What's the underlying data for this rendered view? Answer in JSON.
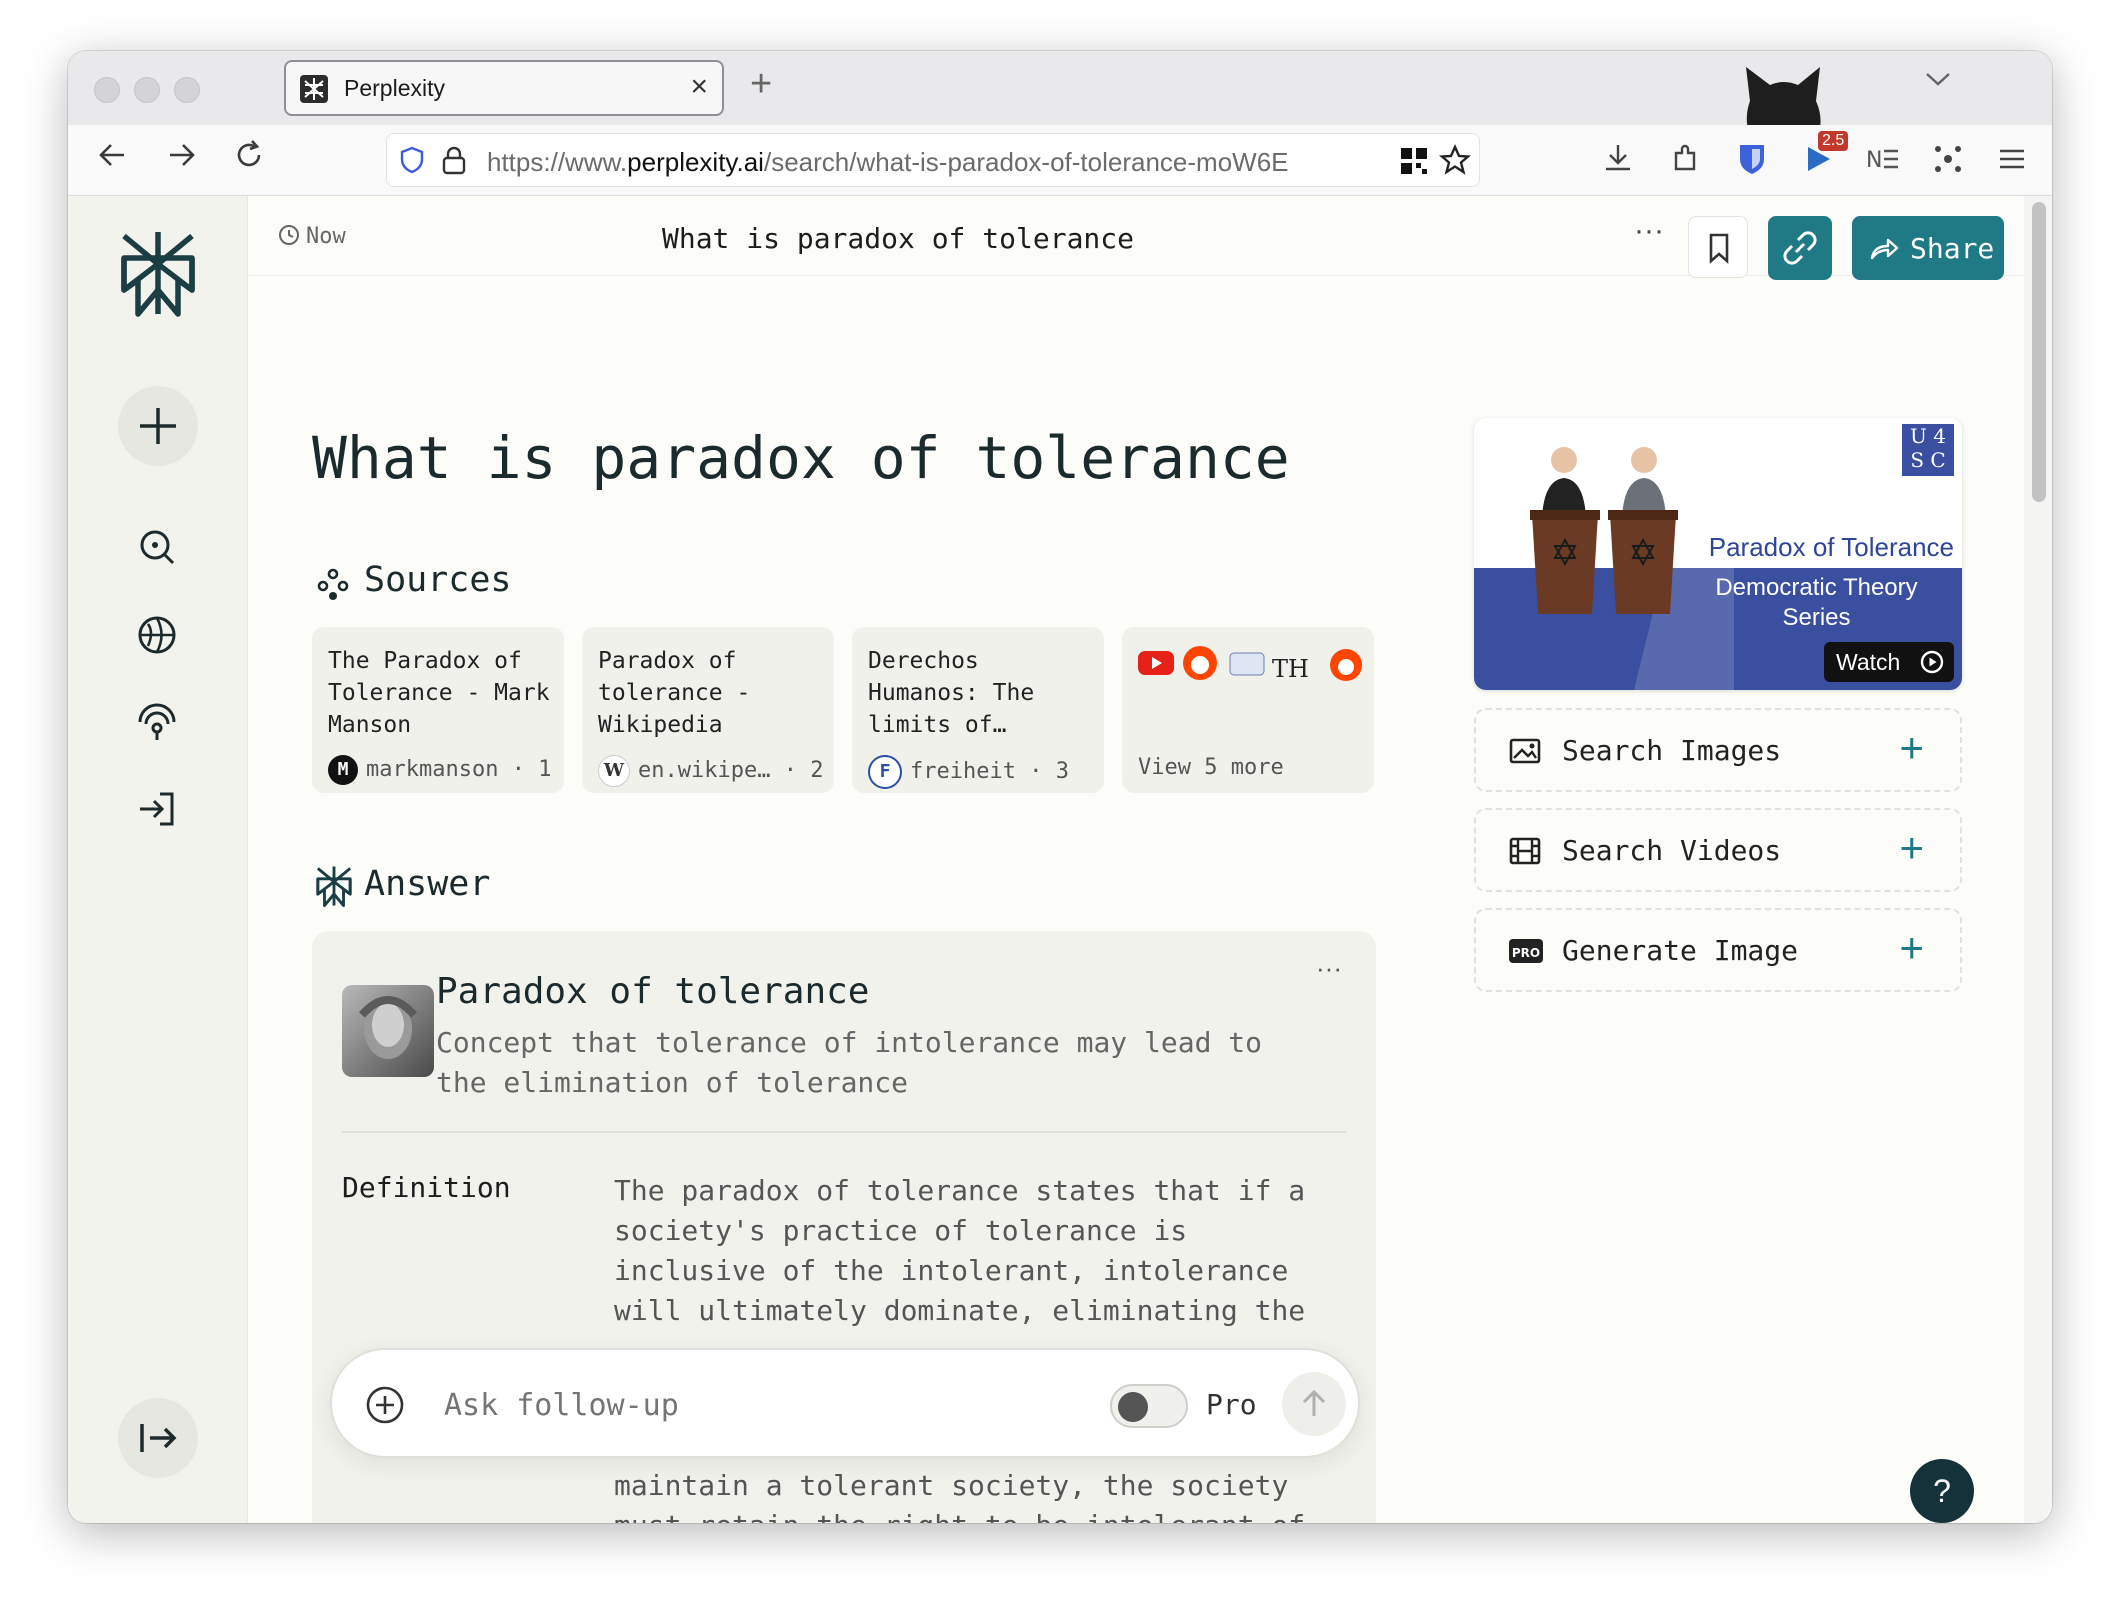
{
  "browser": {
    "tab_title": "Perplexity",
    "url_prefix": "https://www.",
    "url_domain": "perplexity.ai",
    "url_path": "/search/what-is-paradox-of-tolerance-moW6E",
    "badge_count": "2.5"
  },
  "topbar": {
    "time": "Now",
    "title": "What is paradox of tolerance",
    "share_label": "Share"
  },
  "main": {
    "title": "What is paradox of tolerance",
    "sources_heading": "Sources",
    "answer_heading": "Answer"
  },
  "sources": [
    {
      "title": "The Paradox of Tolerance - Mark Manson",
      "site": "markmanson",
      "index": "1",
      "badge": "M"
    },
    {
      "title": "Paradox of tolerance - Wikipedia",
      "site": "en.wikipe…",
      "index": "2",
      "badge": "W"
    },
    {
      "title": "Derechos Humanos: The limits of…",
      "site": "freiheit",
      "index": "3",
      "badge": "F"
    }
  ],
  "view_more": "View 5 more",
  "answer": {
    "entity_title": "Paradox of tolerance",
    "entity_desc": "Concept that tolerance of intolerance may lead to the elimination of tolerance",
    "def_label": "Definition",
    "def_text": "The paradox of tolerance states that if a society's practice of tolerance is inclusive of the intolerant, intolerance will ultimately dominate, eliminating the tolerant and the practice of tolerance with them.",
    "below_text": "maintain a tolerant society, the society must retain the right to be intolerant of intolerance."
  },
  "followup": {
    "placeholder": "Ask follow-up",
    "pro_label": "Pro"
  },
  "video": {
    "logo_top": "U 4",
    "logo_bottom": "S C",
    "title": "Paradox of Tolerance",
    "subtitle_1": "Democratic Theory",
    "subtitle_2": "Series",
    "watch_label": "Watch"
  },
  "actions": [
    {
      "label": "Search Images",
      "icon": "image-icon"
    },
    {
      "label": "Search Videos",
      "icon": "film-icon"
    },
    {
      "label": "Generate Image",
      "icon": "pro-icon"
    }
  ],
  "help_label": "?",
  "colors": {
    "accent": "#1f7a85",
    "video_blue": "#3b4fa0"
  }
}
